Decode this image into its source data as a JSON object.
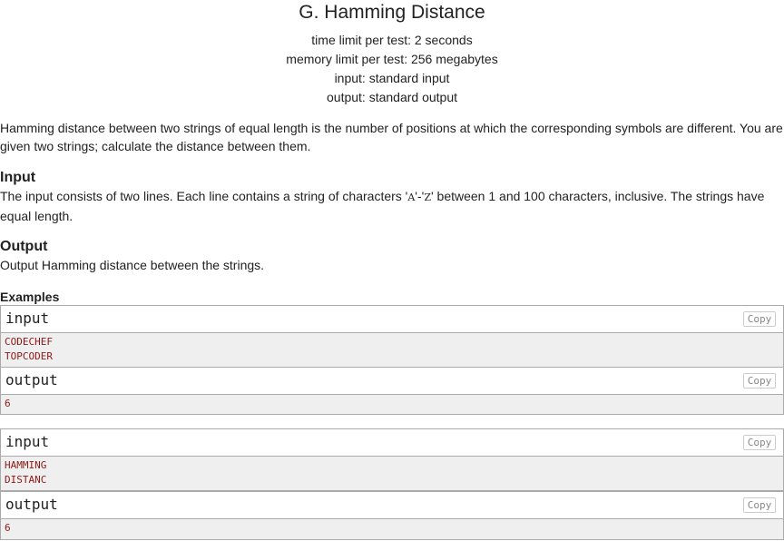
{
  "problem": {
    "title": "G. Hamming Distance",
    "time_limit": "time limit per test: 2 seconds",
    "memory_limit": "memory limit per test: 256 megabytes",
    "input_spec": "input: standard input",
    "output_spec": "output: standard output"
  },
  "statement": {
    "line1": "Hamming distance between two strings of equal length is the number of positions at which the corresponding symbols are different. You are",
    "line2": "given two strings; calculate the distance between them."
  },
  "input_section": {
    "heading": "Input",
    "text_before": "The input consists of two lines. Each line contains a string of characters '",
    "char_a": "A",
    "dash": "'-'",
    "char_z": "Z",
    "text_after": "' between 1 and 100 characters, inclusive. The strings have",
    "line2": "equal length."
  },
  "output_section": {
    "heading": "Output",
    "text": "Output Hamming distance between the strings."
  },
  "examples": {
    "heading": "Examples",
    "input_label": "input",
    "output_label": "output",
    "copy_label": "Copy",
    "items": [
      {
        "input": [
          "CODECHEF",
          "TOPCODER"
        ],
        "output": [
          "6"
        ]
      },
      {
        "input": [
          "HAMMING",
          "DISTANC"
        ],
        "output": [
          "6"
        ]
      }
    ]
  }
}
